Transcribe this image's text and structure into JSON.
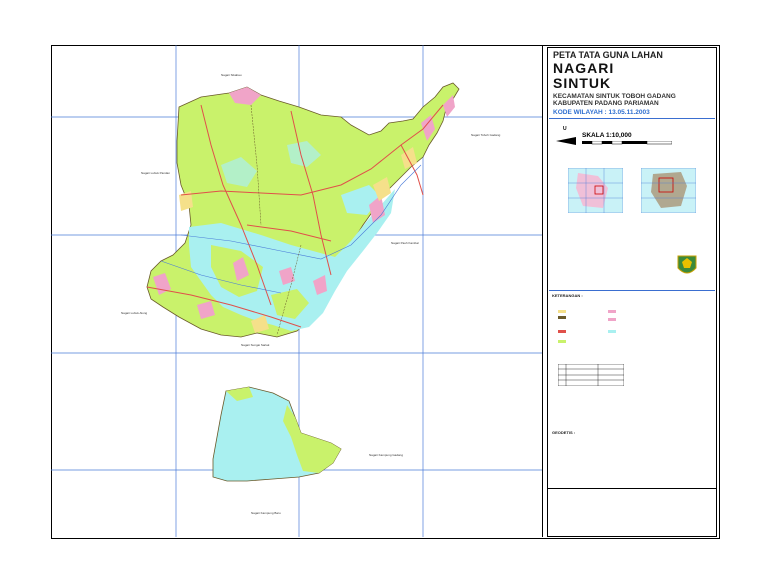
{
  "title": {
    "line1": "PETA TATA GUNA LAHAN",
    "line2": "NAGARI",
    "line3": "SINTUK",
    "kecamatan": "KECAMATAN  SINTUK TOBOH GADANG",
    "kabupaten": "KABUPATEN PADANG PARIAMAN",
    "kode": "KODE WILAYAH :  13.05.11.2003"
  },
  "north": "U",
  "scale": "SKALA 1:10,000",
  "keterangan": "KETERANGAN :",
  "geometri": "GEODETIS :",
  "neighbors": [
    "Nagari Sikabau",
    "Nagari Lubuk Pandan",
    "Nagari Toboh Gadang",
    "Nagari Pauh Kambar",
    "Nagari Lubuk Alung",
    "Nagari Sungai Sariak",
    "Nagari Kampung Gadang",
    "Nagari Kampung Baru",
    "Nagari Sintuk Lubuk Ulak"
  ],
  "colors": {
    "green": "#c9f26b",
    "cyan": "#a9f0f0",
    "pink": "#f0a4c8",
    "yellow": "#f5e08a",
    "road": "#e0504a",
    "grid": "#4a7bd8",
    "boundary": "#6a5a2a"
  }
}
